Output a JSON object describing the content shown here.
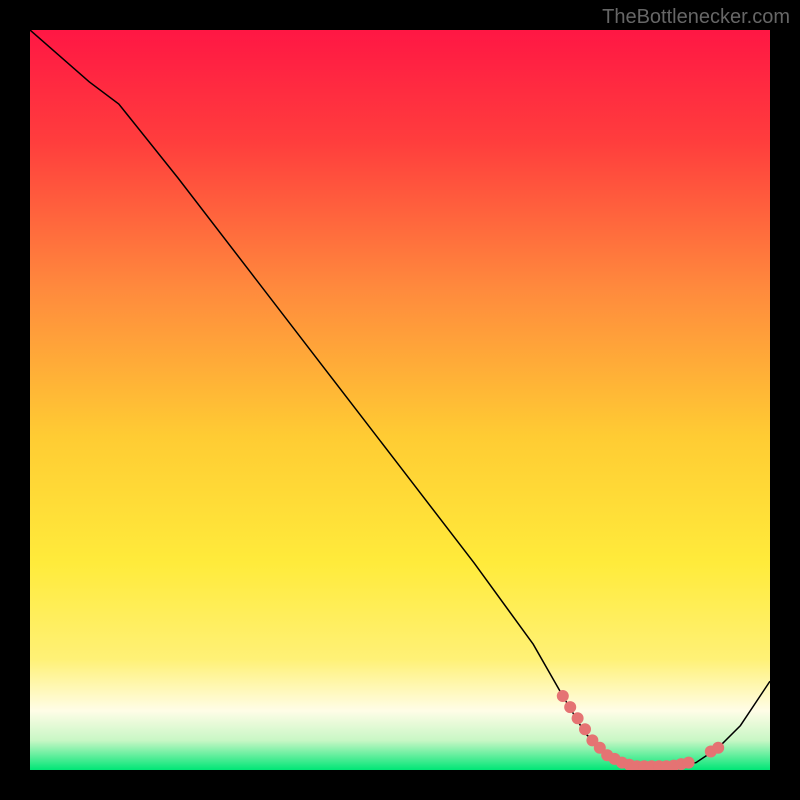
{
  "watermark": "TheBottlenecker.com",
  "chart_data": {
    "type": "line",
    "title": "",
    "xlabel": "",
    "ylabel": "",
    "xlim": [
      0,
      100
    ],
    "ylim": [
      0,
      100
    ],
    "gradient_stops": [
      {
        "offset": 0,
        "color": "#ff1744"
      },
      {
        "offset": 0.15,
        "color": "#ff3d3d"
      },
      {
        "offset": 0.35,
        "color": "#ff8a3d"
      },
      {
        "offset": 0.55,
        "color": "#ffcc33"
      },
      {
        "offset": 0.72,
        "color": "#ffeb3b"
      },
      {
        "offset": 0.85,
        "color": "#fff176"
      },
      {
        "offset": 0.92,
        "color": "#fffde7"
      },
      {
        "offset": 0.96,
        "color": "#c8f7c5"
      },
      {
        "offset": 1.0,
        "color": "#00e676"
      }
    ],
    "series": [
      {
        "name": "curve",
        "color": "#000000",
        "stroke_width": 1.5,
        "points": [
          {
            "x": 0,
            "y": 100
          },
          {
            "x": 8,
            "y": 93
          },
          {
            "x": 12,
            "y": 90
          },
          {
            "x": 20,
            "y": 80
          },
          {
            "x": 30,
            "y": 67
          },
          {
            "x": 40,
            "y": 54
          },
          {
            "x": 50,
            "y": 41
          },
          {
            "x": 60,
            "y": 28
          },
          {
            "x": 68,
            "y": 17
          },
          {
            "x": 72,
            "y": 10
          },
          {
            "x": 75,
            "y": 5
          },
          {
            "x": 78,
            "y": 2
          },
          {
            "x": 82,
            "y": 0.5
          },
          {
            "x": 86,
            "y": 0.5
          },
          {
            "x": 90,
            "y": 1
          },
          {
            "x": 93,
            "y": 3
          },
          {
            "x": 96,
            "y": 6
          },
          {
            "x": 100,
            "y": 12
          }
        ]
      }
    ],
    "highlight_points": [
      {
        "x": 72,
        "y": 10
      },
      {
        "x": 73,
        "y": 8.5
      },
      {
        "x": 74,
        "y": 7
      },
      {
        "x": 75,
        "y": 5.5
      },
      {
        "x": 76,
        "y": 4
      },
      {
        "x": 77,
        "y": 3
      },
      {
        "x": 78,
        "y": 2
      },
      {
        "x": 79,
        "y": 1.5
      },
      {
        "x": 80,
        "y": 1
      },
      {
        "x": 81,
        "y": 0.7
      },
      {
        "x": 82,
        "y": 0.5
      },
      {
        "x": 83,
        "y": 0.5
      },
      {
        "x": 84,
        "y": 0.5
      },
      {
        "x": 85,
        "y": 0.5
      },
      {
        "x": 86,
        "y": 0.5
      },
      {
        "x": 87,
        "y": 0.6
      },
      {
        "x": 88,
        "y": 0.8
      },
      {
        "x": 89,
        "y": 1
      },
      {
        "x": 92,
        "y": 2.5
      },
      {
        "x": 93,
        "y": 3
      }
    ],
    "highlight_color": "#e57373",
    "highlight_radius": 6
  }
}
